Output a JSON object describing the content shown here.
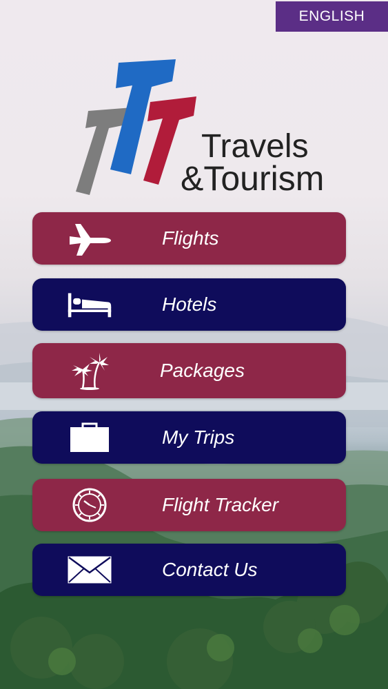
{
  "header": {
    "language_button": "ENGLISH"
  },
  "brand": {
    "logo_numerals": "777",
    "logo_line1": "Travels",
    "logo_line2": "&Tourism",
    "logo_colors": [
      "#7d7d7d",
      "#1f6ac4",
      "#b11c3a"
    ]
  },
  "menu": {
    "items": [
      {
        "label": "Flights",
        "icon": "airplane-icon",
        "color": "#8e2748"
      },
      {
        "label": "Hotels",
        "icon": "bed-icon",
        "color": "#0f0c5b"
      },
      {
        "label": "Packages",
        "icon": "palm-trees-icon",
        "color": "#8e2748"
      },
      {
        "label": "My Trips",
        "icon": "briefcase-icon",
        "color": "#0f0c5b"
      },
      {
        "label": "Flight Tracker",
        "icon": "clock-icon",
        "color": "#8e2748"
      },
      {
        "label": "Contact Us",
        "icon": "envelope-icon",
        "color": "#0f0c5b"
      }
    ]
  }
}
